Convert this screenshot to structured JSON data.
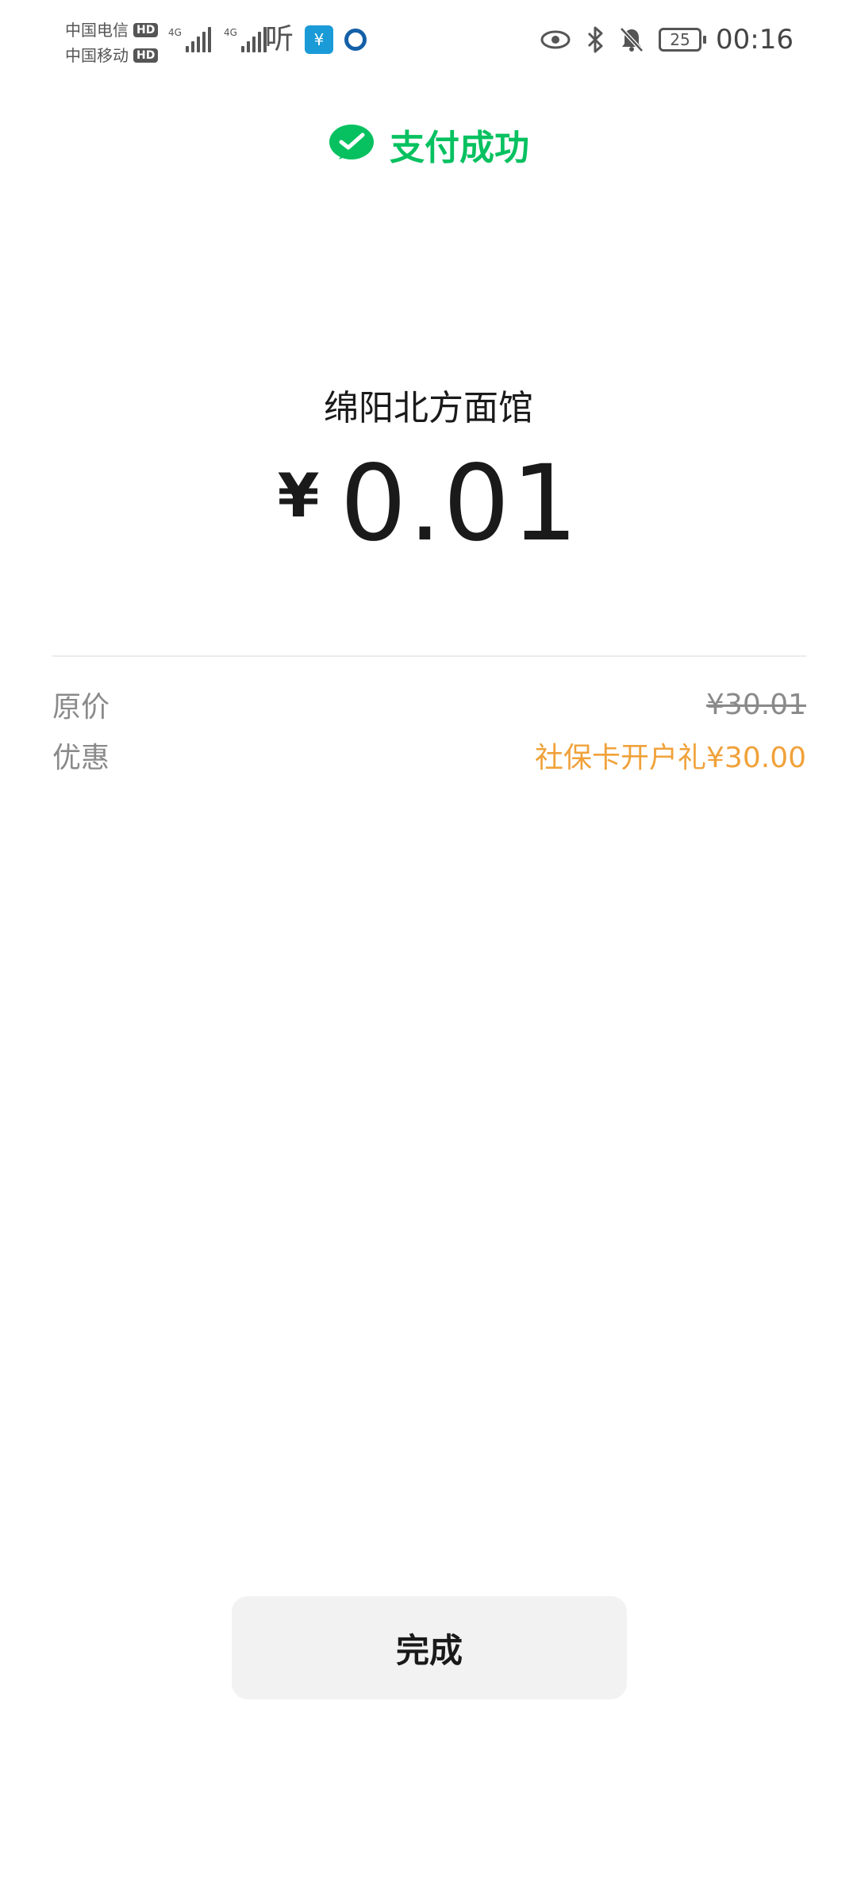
{
  "status_bar": {
    "carrier_1": "中国电信",
    "carrier_2": "中国移动",
    "hd_badge": "HD",
    "network_tag": "4G",
    "ting_glyph": "听",
    "app_glyph": "¥",
    "battery": "25",
    "time": "00:16"
  },
  "header": {
    "title": "支付成功",
    "accent_color": "#07c160"
  },
  "payment": {
    "merchant": "绵阳北方面馆",
    "currency_symbol": "¥",
    "amount": "0.01"
  },
  "details": {
    "original_label": "原价",
    "original_value": "¥30.01",
    "discount_label": "优惠",
    "discount_value": "社保卡开户礼¥30.00",
    "discount_color": "#f0a23a"
  },
  "actions": {
    "done_label": "完成"
  }
}
